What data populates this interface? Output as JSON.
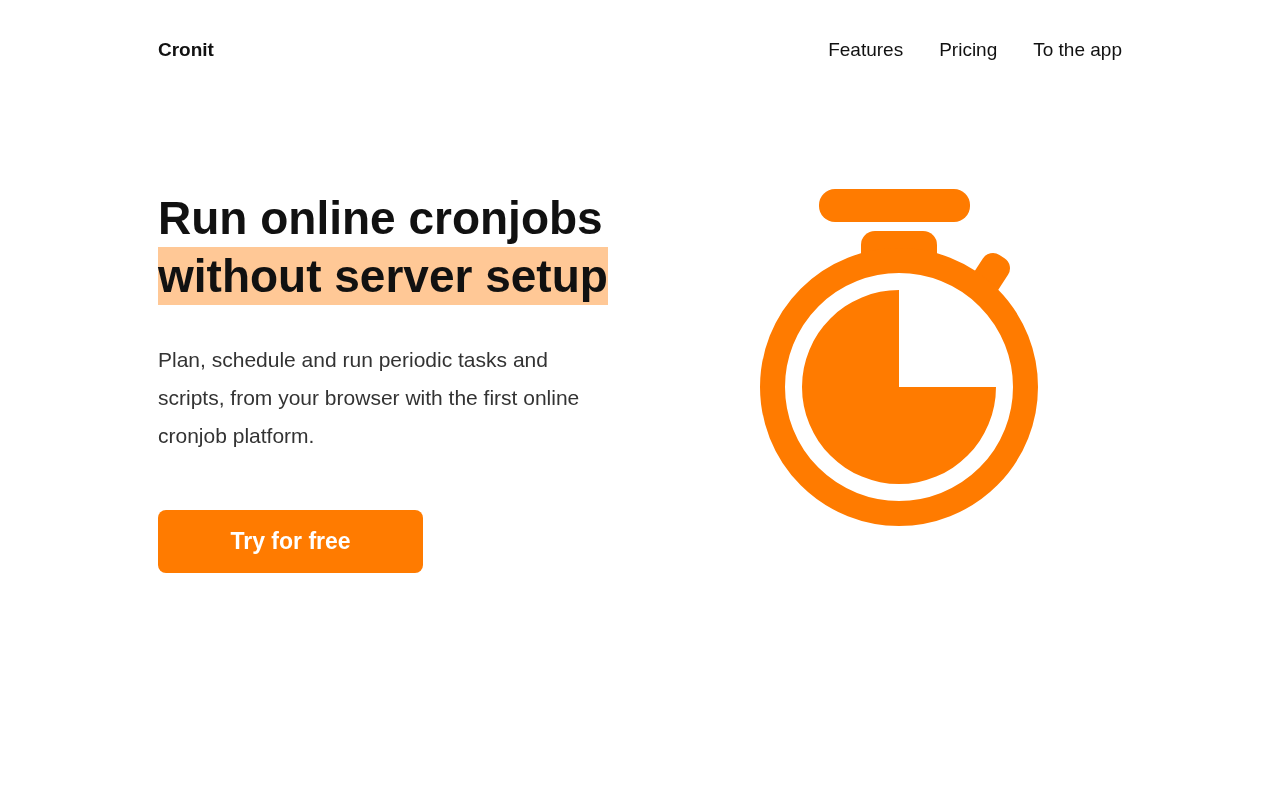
{
  "nav": {
    "brand": "Cronit",
    "links": [
      "Features",
      "Pricing",
      "To the app"
    ]
  },
  "hero": {
    "headline": [
      {
        "text": "Run online cronjobs",
        "highlighted": false
      },
      {
        "text": "without server setup",
        "highlighted": true
      }
    ],
    "description": "Plan, schedule and run periodic tasks and scripts, from your browser with the first online cronjob platform.",
    "cta": "Try for free"
  }
}
